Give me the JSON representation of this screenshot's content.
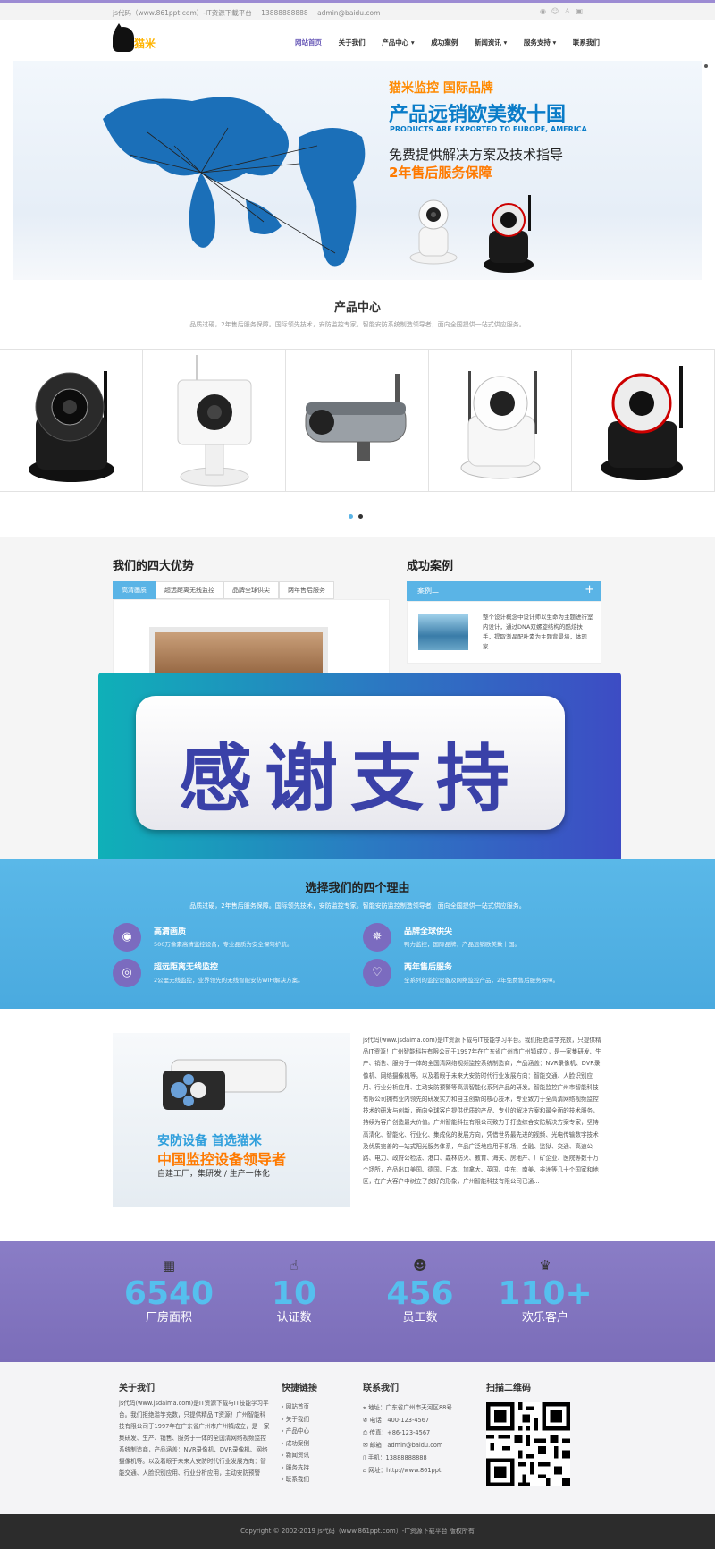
{
  "topbar": {
    "site": "js代码（www.861ppt.com）-IT资源下载平台",
    "phone": "13888888888",
    "email": "admin@baidu.com"
  },
  "header": {
    "logo_text": "猫米",
    "nav": [
      "网站首页",
      "关于我们",
      "产品中心 ▾",
      "成功案例",
      "新闻资讯 ▾",
      "服务支持 ▾",
      "联系我们"
    ]
  },
  "banner": {
    "line1": "猫米监控  国际品牌",
    "line2": "产品远销欧美数十国",
    "line3": "PRODUCTS ARE EXPORTED TO EUROPE, AMERICA",
    "line4": "免费提供解决方案及技术指导",
    "line5": "2年售后服务保障"
  },
  "products": {
    "title": "产品中心",
    "subtitle": "品质过硬，2年售后服务保障。国际领先技术，安防监控专家。智能安防系统制造领导者，面向全国提供一站式供应服务。"
  },
  "advantages": {
    "title": "我们的四大优势",
    "tabs": [
      "高清画质",
      "超远距离无线监控",
      "品牌全球供尖",
      "两年售后服务"
    ]
  },
  "cases": {
    "title": "成功案例",
    "bar_label": "案例二",
    "text": "整个设计概念中设计师以生命为主题进行室内设计，通过DNA双螺旋结构的酷炫扶手，提取渐晶配叶素为主题背景墙，体现家..."
  },
  "overlay": {
    "text": "感谢支持"
  },
  "reasons": {
    "title": "选择我们的四个理由",
    "subtitle": "品质过硬，2年售后服务保障。国际领先技术，安防监控专家。智能安防监控制造领导者，面向全国提供一站式供应服务。",
    "items": [
      {
        "title": "高清画质",
        "desc": "500万像素高清监控设备，专业品质为安全保驾护航。",
        "icon": "eye-icon"
      },
      {
        "title": "品牌全球供尖",
        "desc": "鸭力监控，国际品牌，产品远销欧美数十国。",
        "icon": "gear-icon"
      },
      {
        "title": "超远距离无线监控",
        "desc": "2公里无线监控，业界领先的无线智能安防WIFI解决方案。",
        "icon": "target-icon"
      },
      {
        "title": "两年售后服务",
        "desc": "全系列的监控设备及网络监控产品，2年免费售后服务保障。",
        "icon": "heart-icon"
      }
    ]
  },
  "about": {
    "img_line1": "安防设备 首选猫米",
    "img_line2": "中国监控设备领导者",
    "img_line3": "自建工厂，集研发 / 生产一体化",
    "text": "js代码(www.jsdaima.com)是IT资源下载与IT技能学习平台。我们拒绝滥竽充数，只提供精品IT资源！广州智能科技有限公司于1997年在广东省广州市广州镇成立，是一家集研发、生产、销售、服务于一体的全国清网络视频监控系统制造商，产品涵盖：NVR录像机、DVR录像机、网络摄像机等。以及着眼于未来大安防时代行业发展方向：智能交通、人脸识别应用、行业分析应用、主动安防预警等高清智能化系列产品的研发。智能监控广州市智能科技有限公司拥有业内领先的研发实力和自主创新的核心技术，专业致力于全高清网络视频监控技术的研发与创新，面向全球客户提供优质的产品、专业的解决方案和最全面的技术服务，持续为客户创造最大价值。广州智能科技有限公司致力于打造综合安防解决方案专家，坚持高清化、智能化、行业化、集成化的发展方向，凭借世界最先进的视频、光电传输数字技术及优质完善的一站式阳光服务体系，产品广泛地应用于机场、金融、监狱、交通、高速公路、电力、政府公检法、港口、森林防火、教育、海关、房地产、厂矿企业、医院等数十万个场所，产品出口美国、德国、日本、加拿大、英国、中东、南美、非洲等几十个国家和地区，在广大客户中树立了良好的形象，广州智能科技有限公司已通..."
  },
  "stats": [
    {
      "value": "6540",
      "label": "厂房面积",
      "icon": "building-icon"
    },
    {
      "value": "10",
      "label": "认证数",
      "icon": "thumbs-up-icon"
    },
    {
      "value": "456",
      "label": "员工数",
      "icon": "users-icon"
    },
    {
      "value": "110+",
      "label": "欢乐客户",
      "icon": "trophy-icon"
    }
  ],
  "footer": {
    "about_title": "关于我们",
    "about_text": "js代码(www.jsdaima.com)是IT资源下载与IT技能学习平台。我们拒绝滥竽充数，只提供精品IT资源！广州智能科技有限公司于1997年在广东省广州市广州镇成立，是一家集研发、生产、销售、服务于一体的全国清网络视频监控系统制造商，产品涵盖：NVR录像机、DVR录像机、网络摄像机等。以及着眼于未来大安防时代行业发展方向：智能交通、人脸识别应用、行业分析应用，主动安防预警",
    "links_title": "快捷链接",
    "links": [
      "网站首页",
      "关于我们",
      "产品中心",
      "成功案例",
      "新闻资讯",
      "服务支持",
      "联系我们"
    ],
    "contact_title": "联系我们",
    "contact": [
      "地址：广东省广州市天河区88号",
      "电话：400-123-4567",
      "传真：+86-123-4567",
      "邮箱：admin@baidu.com",
      "手机：13888888888",
      "网址：http://www.861ppt"
    ],
    "qr_title": "扫描二维码"
  },
  "copyright": "Copyright © 2002-2019 js代码（www.861ppt.com）-IT资源下载平台 版权所有",
  "colors": {
    "accent": "#5ab4e6",
    "purple": "#7b6db9",
    "orange": "#ff7a00"
  }
}
